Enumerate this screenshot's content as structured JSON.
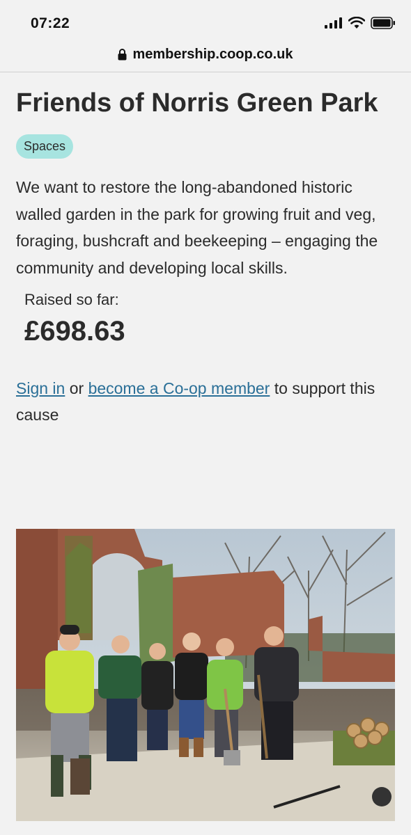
{
  "status_bar": {
    "time": "07:22"
  },
  "browser": {
    "url": "membership.coop.co.uk"
  },
  "cause": {
    "title": "Friends of Norris Green Park",
    "tag": "Spaces",
    "description": "We want to restore the long-abandoned historic walled garden in the park for growing fruit and veg, foraging, bushcraft and beekeeping – engaging the community and developing local skills.",
    "raised_label": "Raised so far:",
    "raised_amount": "£698.63"
  },
  "cta": {
    "sign_in": "Sign in",
    "or": "or",
    "become_member": "become a Co-op member",
    "to_support": "to support this cause"
  },
  "colors": {
    "background": "#f2f2f2",
    "tag_bg": "#a7e4e0",
    "link": "#2a6f97"
  }
}
